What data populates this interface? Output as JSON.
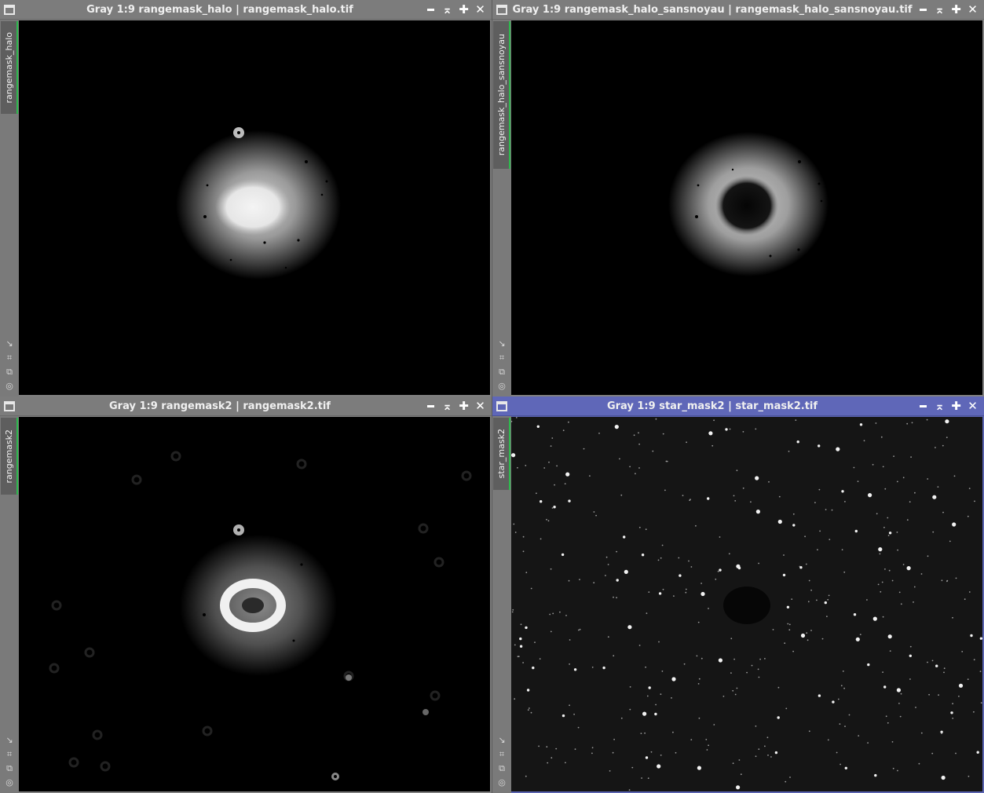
{
  "windows": [
    {
      "title": "Gray 1:9 rangemask_halo | rangemask_halo.tif",
      "tab": "rangemask_halo",
      "active": false
    },
    {
      "title": "Gray 1:9 rangemask_halo_sansnoyau | rangemask_halo_sansnoyau.tif",
      "tab": "rangemask_halo_sansnoyau",
      "active": false
    },
    {
      "title": "Gray 1:9 rangemask2 | rangemask2.tif",
      "tab": "rangemask2",
      "active": false
    },
    {
      "title": "Gray 1:9 star_mask2 | star_mask2.tif",
      "tab": "star_mask2",
      "active": true
    }
  ],
  "window_buttons": {
    "shade": "⌅",
    "maximize": "✚",
    "close": "✕"
  },
  "side_icons": [
    "↘",
    "⌗",
    "⧉",
    "◎"
  ],
  "colors": {
    "titlebar_inactive": "#7c7c7c",
    "titlebar_active": "#5f67b8",
    "tab_accent": "#2fb84e"
  }
}
